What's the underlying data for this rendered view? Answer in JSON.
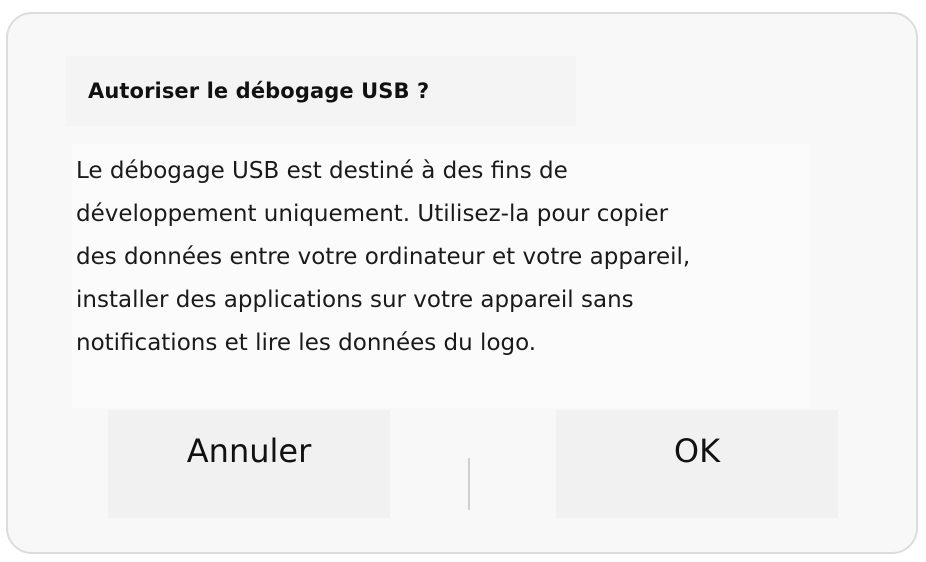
{
  "dialog": {
    "title": "Autoriser le débogage USB ?",
    "message": "Le débogage USB est destiné à des fins de\ndéveloppement uniquement. Utilisez-la pour copier\ndes données entre votre ordinateur et votre appareil,\ninstaller des applications sur votre appareil sans\nnotifications et lire les données du logo.",
    "buttons": {
      "cancel": "Annuler",
      "ok": "OK"
    }
  },
  "colors": {
    "dialog_background": "#f8f8f8",
    "dialog_border": "#dcdcdc",
    "text": "#111111",
    "button_background": "#f1f1f1"
  }
}
